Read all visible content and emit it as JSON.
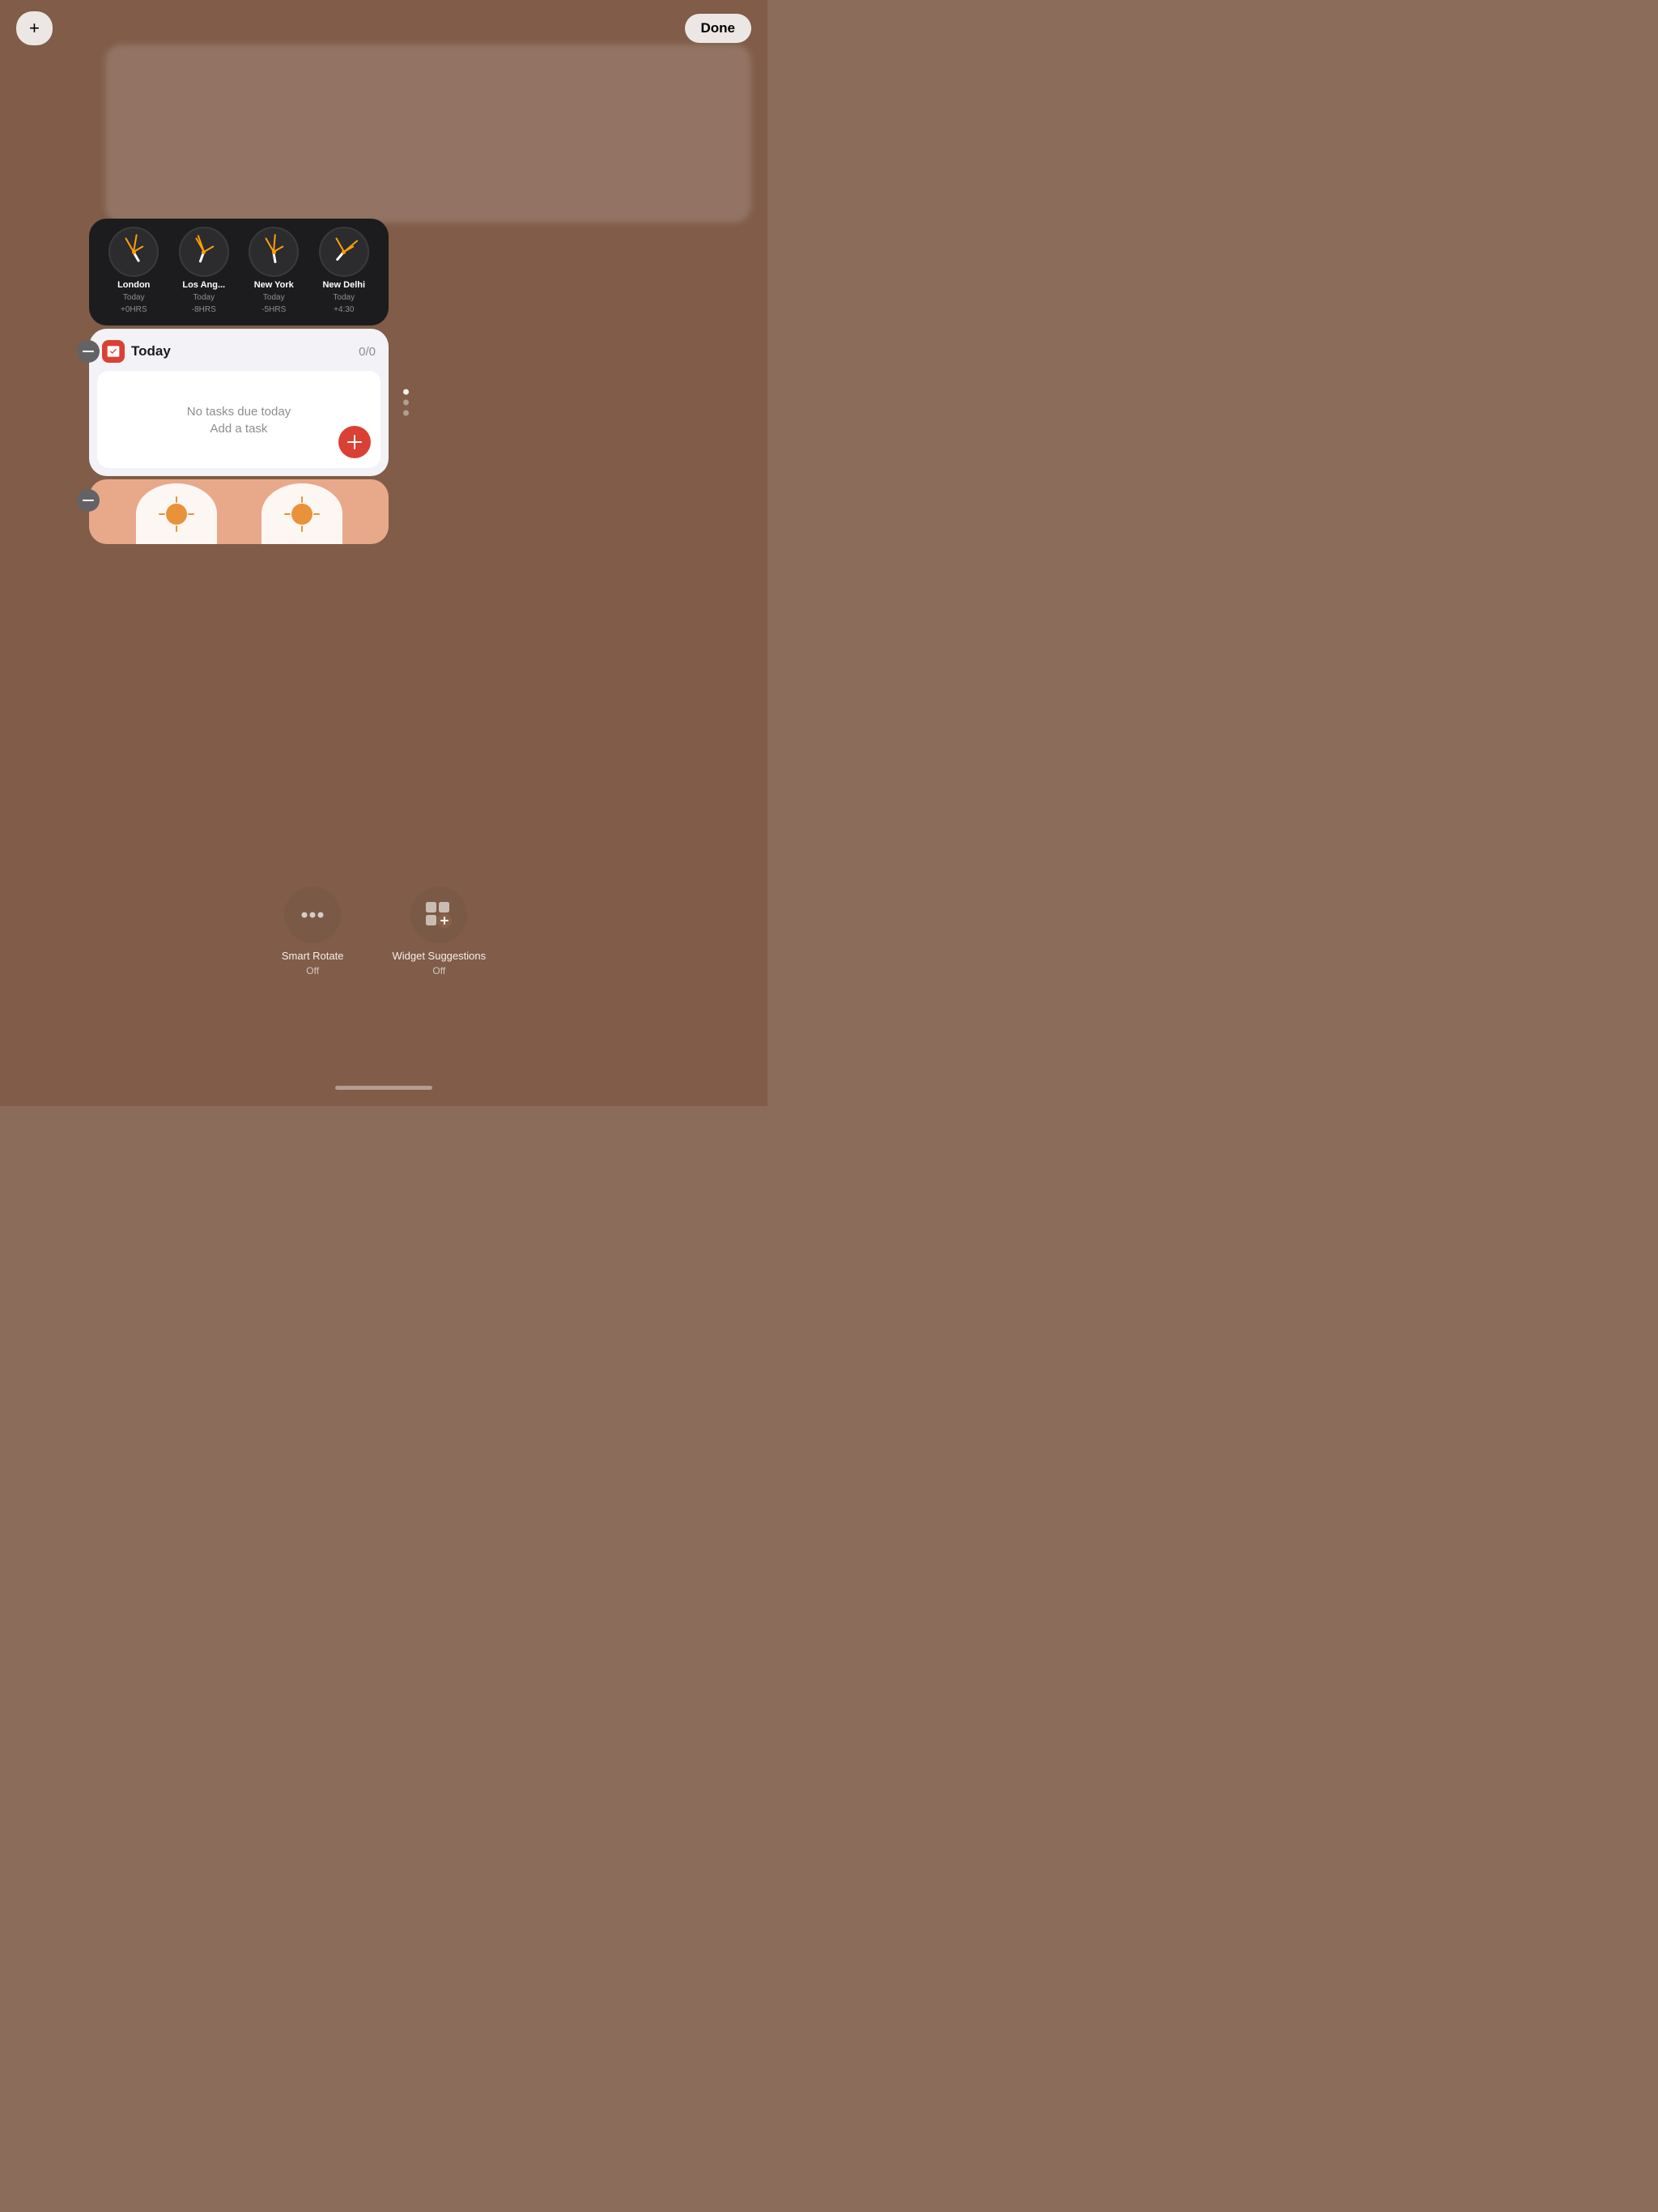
{
  "topBar": {
    "addLabel": "+",
    "doneLabel": "Done"
  },
  "clockWidget": {
    "cities": [
      {
        "name": "London",
        "subLabel": "Today",
        "offset": "+0HRS"
      },
      {
        "name": "Los Ang...",
        "subLabel": "Today",
        "offset": "-8HRS"
      },
      {
        "name": "New York",
        "subLabel": "Today",
        "offset": "-5HRS"
      },
      {
        "name": "New Delhi",
        "subLabel": "Today",
        "offset": "+4:30"
      }
    ]
  },
  "todayWidget": {
    "title": "Today",
    "count": "0/0",
    "noTasksText": "No tasks due today",
    "addTaskText": "Add a task"
  },
  "bottomControls": {
    "smartRotate": {
      "label": "Smart Rotate",
      "sublabel": "Off"
    },
    "widgetSuggestions": {
      "label": "Widget Suggestions",
      "sublabel": "Off"
    }
  },
  "pageDots": [
    "active",
    "inactive",
    "inactive"
  ]
}
